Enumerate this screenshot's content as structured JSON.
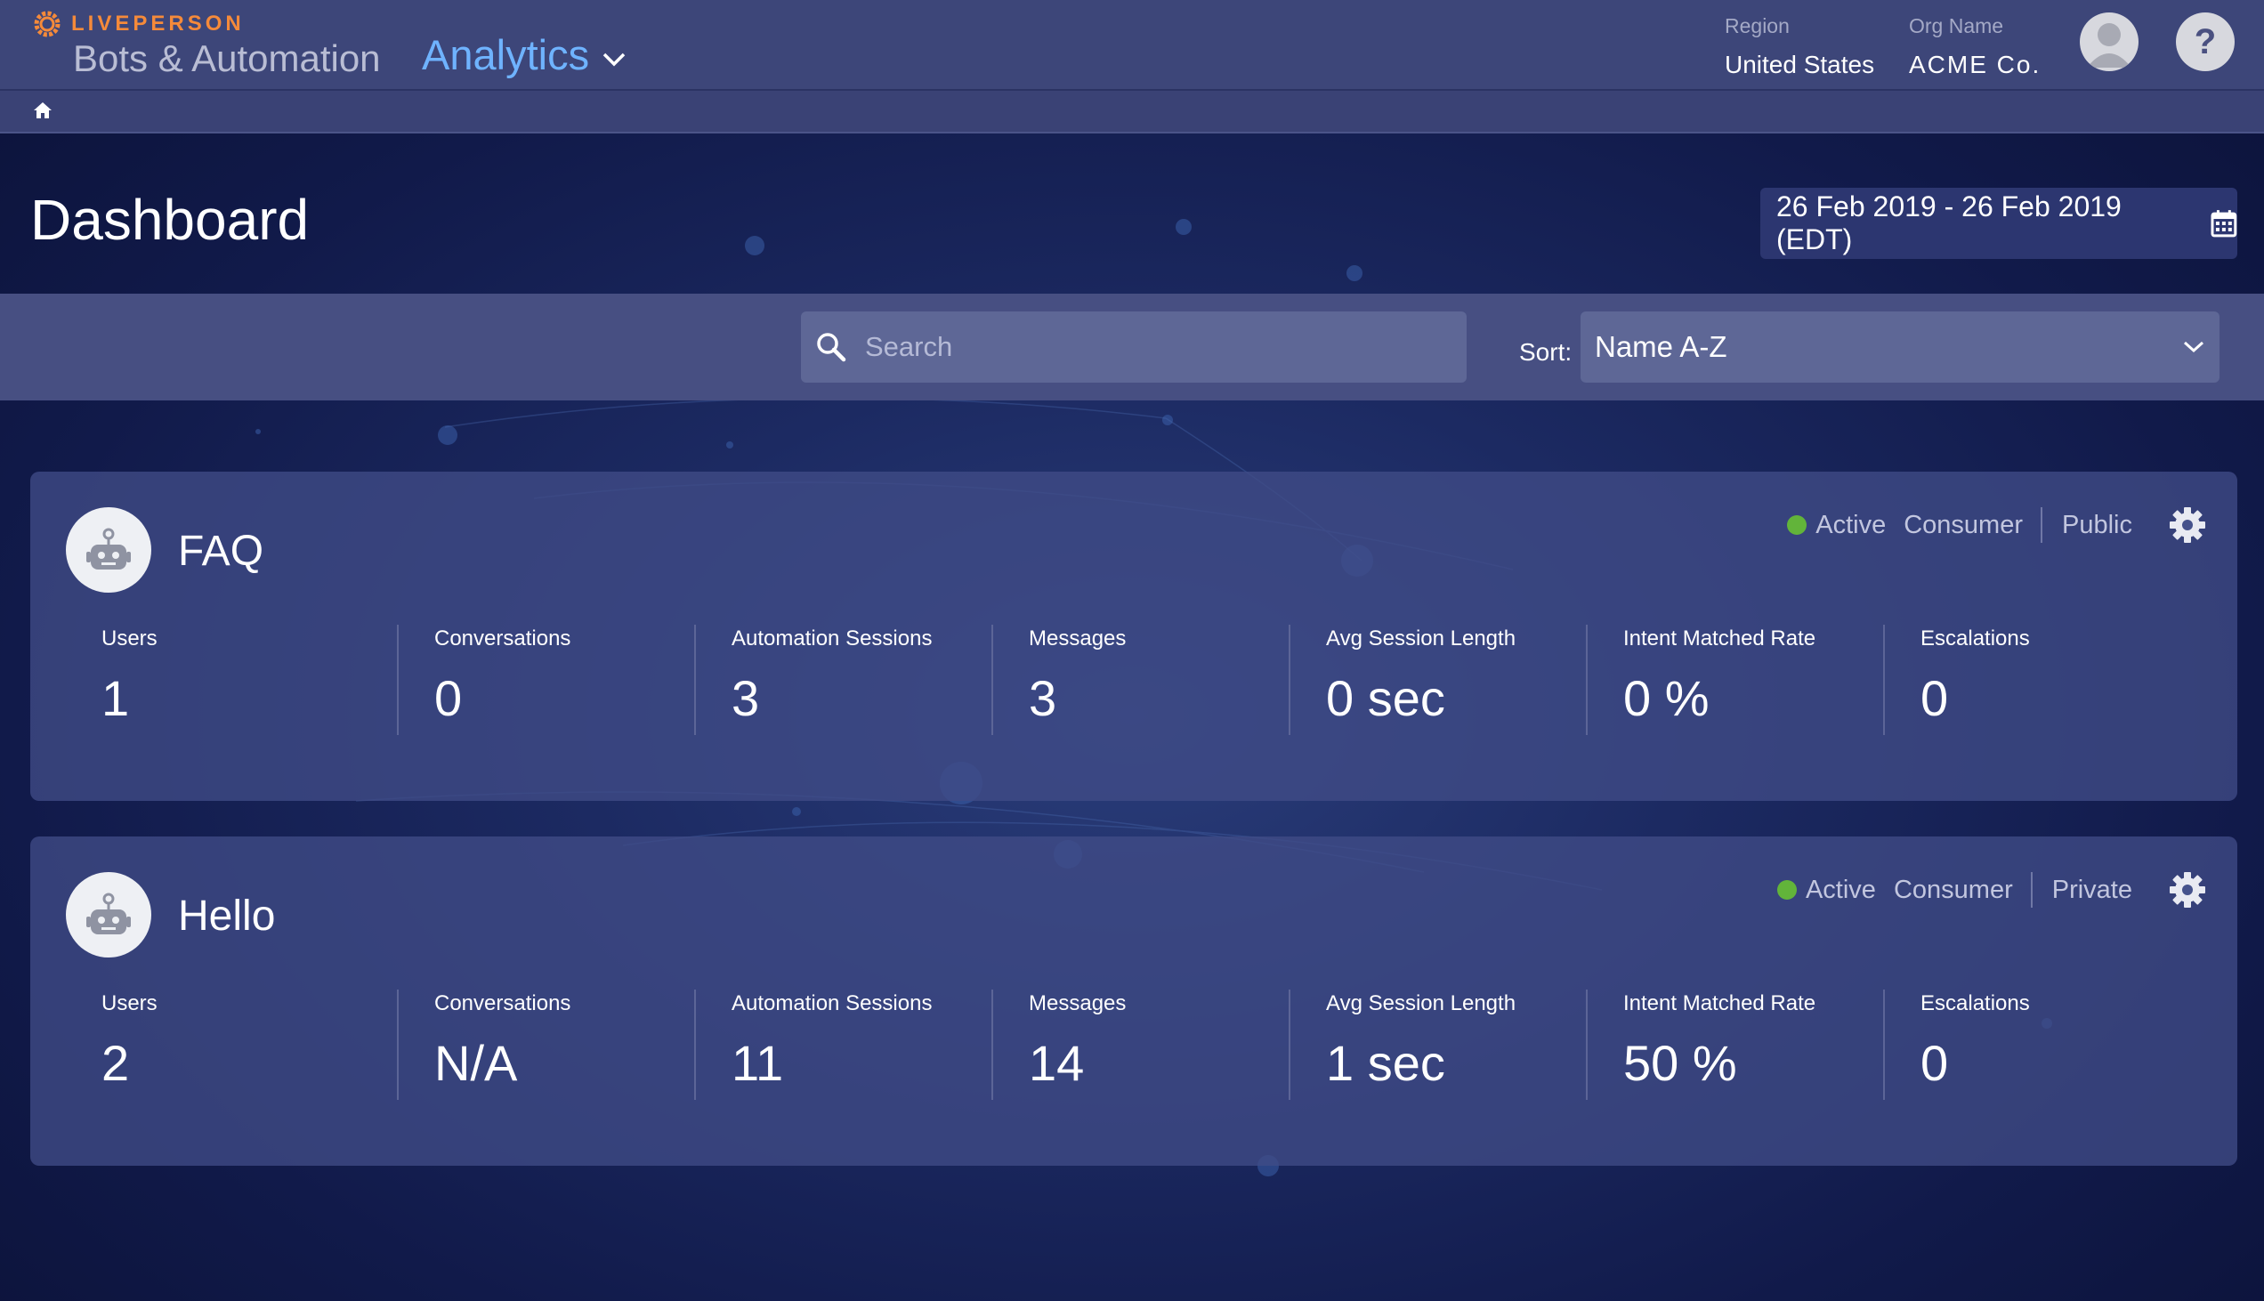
{
  "header": {
    "brand": "LIVEPERSON",
    "app_title": "Bots & Automation",
    "section": "Analytics",
    "region_label": "Region",
    "region_value": "United States",
    "org_label": "Org Name",
    "org_value": "ACME Co.",
    "help_label": "?"
  },
  "page": {
    "title": "Dashboard",
    "date_range": "26 Feb 2019 - 26 Feb 2019 (EDT)"
  },
  "filters": {
    "search_placeholder": "Search",
    "sort_label": "Sort:",
    "sort_value": "Name A-Z"
  },
  "colors": {
    "accent": "#6fb3ff",
    "brand": "#f58a3a",
    "active_status": "#62b43a"
  },
  "bots": [
    {
      "name": "FAQ",
      "status": "Active",
      "type": "Consumer",
      "visibility": "Public",
      "metrics": [
        {
          "label": "Users",
          "value": "1"
        },
        {
          "label": "Conversations",
          "value": "0"
        },
        {
          "label": "Automation Sessions",
          "value": "3"
        },
        {
          "label": "Messages",
          "value": "3"
        },
        {
          "label": "Avg Session Length",
          "value": "0 sec"
        },
        {
          "label": "Intent Matched Rate",
          "value": "0 %"
        },
        {
          "label": "Escalations",
          "value": "0"
        }
      ]
    },
    {
      "name": "Hello",
      "status": "Active",
      "type": "Consumer",
      "visibility": "Private",
      "metrics": [
        {
          "label": "Users",
          "value": "2"
        },
        {
          "label": "Conversations",
          "value": "N/A"
        },
        {
          "label": "Automation Sessions",
          "value": "11"
        },
        {
          "label": "Messages",
          "value": "14"
        },
        {
          "label": "Avg Session Length",
          "value": "1 sec"
        },
        {
          "label": "Intent Matched Rate",
          "value": "50 %"
        },
        {
          "label": "Escalations",
          "value": "0"
        }
      ]
    }
  ]
}
